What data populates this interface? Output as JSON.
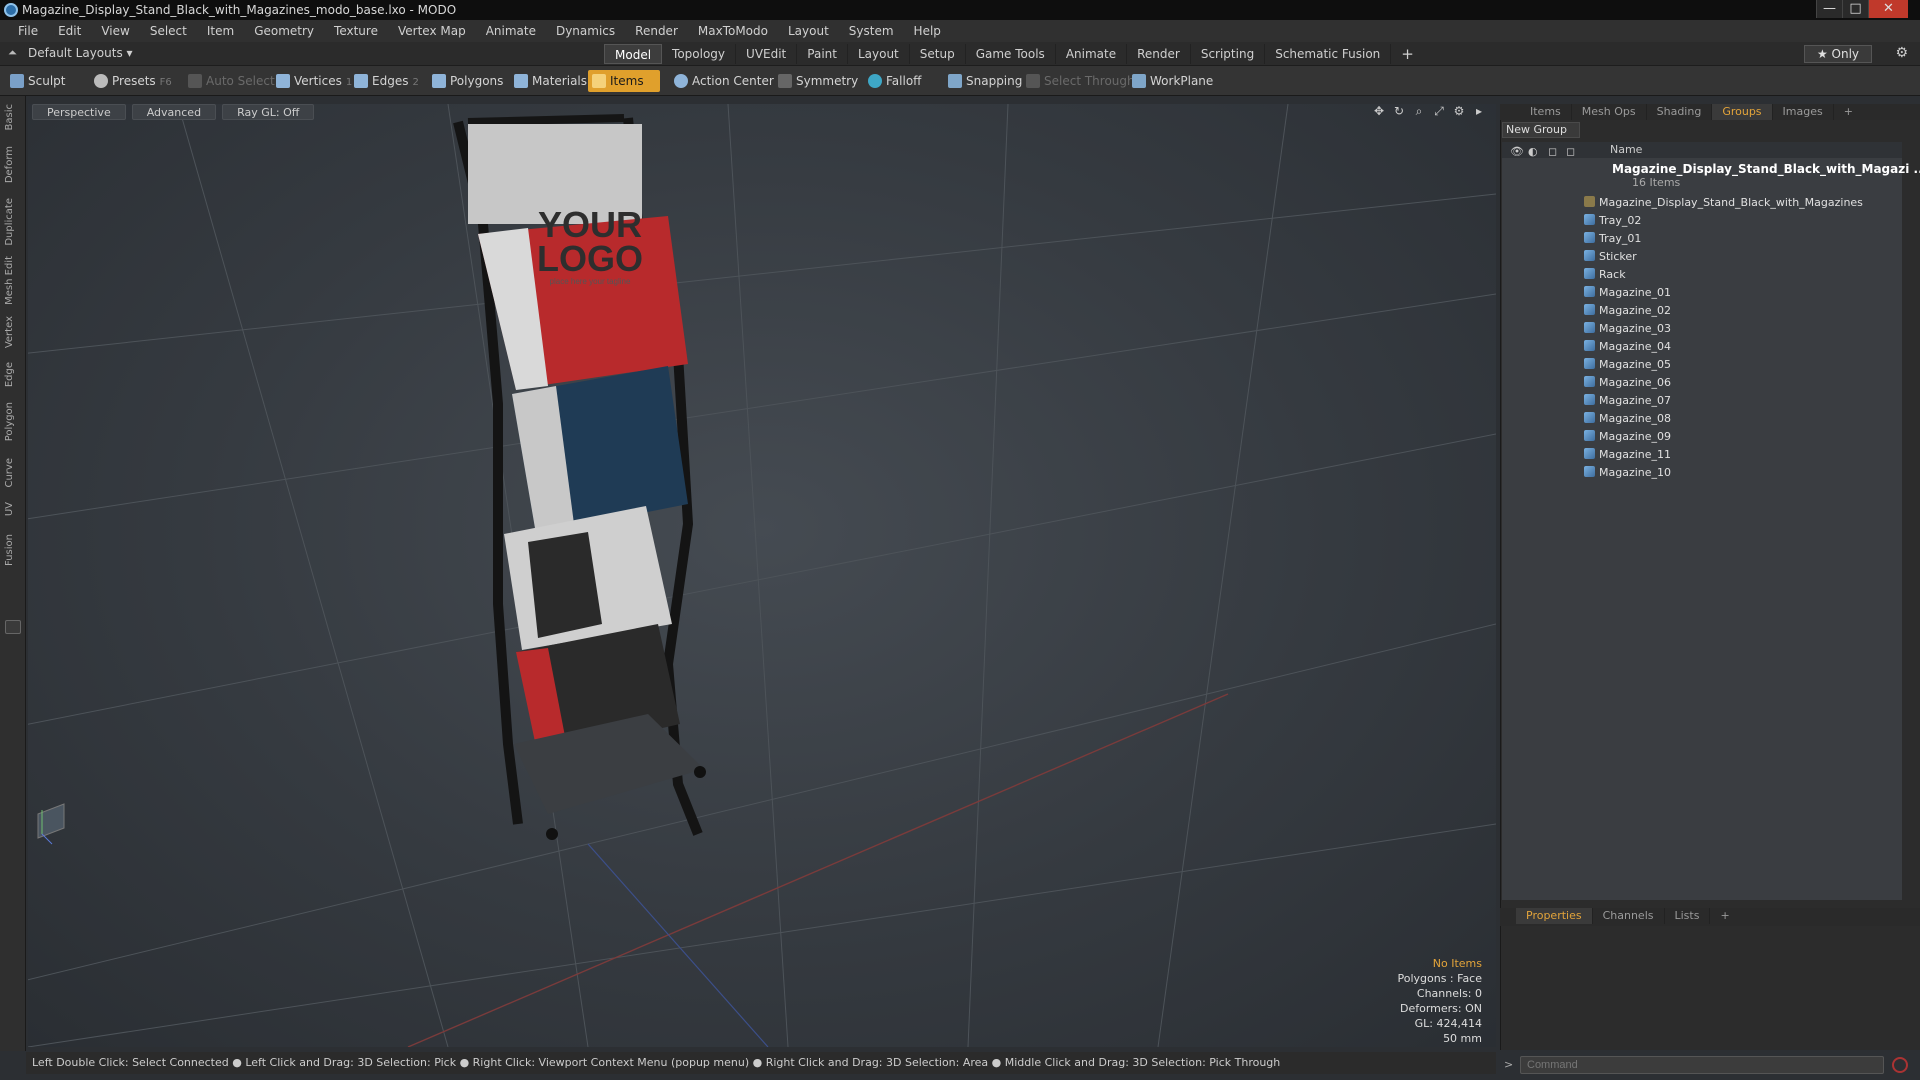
{
  "window": {
    "title": "Magazine_Display_Stand_Black_with_Magazines_modo_base.lxo - MODO",
    "minimize": "—",
    "maximize": "□",
    "close": "✕"
  },
  "menu": [
    "File",
    "Edit",
    "View",
    "Select",
    "Item",
    "Geometry",
    "Texture",
    "Vertex Map",
    "Animate",
    "Dynamics",
    "Render",
    "MaxToModo",
    "Layout",
    "System",
    "Help"
  ],
  "layout": {
    "selector": "Default Layouts ▾",
    "tabs": [
      "Model",
      "Topology",
      "UVEdit",
      "Paint",
      "Layout",
      "Setup",
      "Game Tools",
      "Animate",
      "Render",
      "Scripting",
      "Schematic Fusion"
    ],
    "active_tab": "Model",
    "add": "+",
    "only": "★ Only"
  },
  "toolbar": {
    "sculpt": "Sculpt",
    "presets": "Presets",
    "presets_key": "F6",
    "auto_select": "Auto Select",
    "vertices": "Vertices",
    "vertices_key": "1",
    "edges": "Edges",
    "edges_key": "2",
    "polygons": "Polygons",
    "materials": "Materials",
    "items": "Items",
    "action_center": "Action Center",
    "symmetry": "Symmetry",
    "falloff": "Falloff",
    "snapping": "Snapping",
    "select_through": "Select Through",
    "workplane": "WorkPlane"
  },
  "left_tabs": [
    "Basic",
    "Deform",
    "Duplicate",
    "Mesh Edit",
    "Vertex",
    "Edge",
    "Polygon",
    "Curve",
    "UV",
    "Fusion"
  ],
  "viewport": {
    "view": "Perspective",
    "mode": "Advanced",
    "raygl": "Ray GL: Off",
    "logo_line1": "YOUR",
    "logo_line2": "LOGO",
    "logo_tagline": "place here your tagline"
  },
  "stats": {
    "no_items": "No Items",
    "polygons": "Polygons : Face",
    "channels": "Channels: 0",
    "deformers": "Deformers: ON",
    "gl": "GL: 424,414",
    "scale": "50 mm"
  },
  "statusbar": "Left Double Click: Select Connected ● Left Click and Drag: 3D Selection: Pick ● Right Click: Viewport Context Menu (popup menu) ● Right Click and Drag: 3D Selection: Area ● Middle Click and Drag: 3D Selection: Pick Through",
  "right_panel": {
    "tabs": [
      "Items",
      "Mesh Ops",
      "Shading",
      "Groups",
      "Images"
    ],
    "active_tab": "Groups",
    "add": "+",
    "new_group": "New Group",
    "col_name": "Name",
    "root": "Magazine_Display_Stand_Black_with_Magazi ...",
    "root_count": "16 Items",
    "items": [
      "Magazine_Display_Stand_Black_with_Magazines",
      "Tray_02",
      "Tray_01",
      "Sticker",
      "Rack",
      "Magazine_01",
      "Magazine_02",
      "Magazine_03",
      "Magazine_04",
      "Magazine_05",
      "Magazine_06",
      "Magazine_07",
      "Magazine_08",
      "Magazine_09",
      "Magazine_11",
      "Magazine_10"
    ],
    "bottom_tabs": [
      "Properties",
      "Channels",
      "Lists"
    ],
    "bottom_active": "Properties",
    "command_placeholder": "Command"
  }
}
